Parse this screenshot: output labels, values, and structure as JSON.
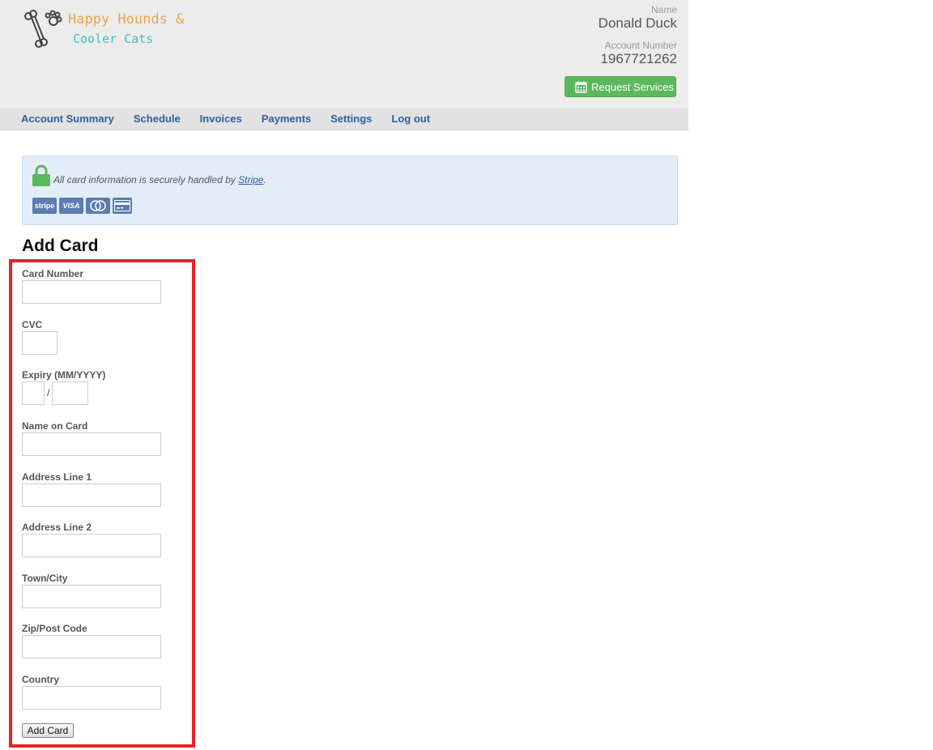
{
  "header": {
    "logo_line1": "Happy Hounds &",
    "logo_line2": "Cooler Cats",
    "name_label": "Name",
    "name_value": "Donald Duck",
    "account_label": "Account Number",
    "account_value": "1967721262",
    "request_button": "Request Services",
    "request_icon": "calendar-icon"
  },
  "nav": {
    "items": [
      "Account Summary",
      "Schedule",
      "Invoices",
      "Payments",
      "Settings",
      "Log out"
    ]
  },
  "notice": {
    "text_before": "All card information is securely handled by ",
    "link_text": "Stripe",
    "text_after": ".",
    "lock_icon": "lock-icon",
    "card_logos": [
      "stripe",
      "VISA",
      "mastercard",
      "generic-card"
    ]
  },
  "form": {
    "title": "Add Card",
    "card_number_label": "Card Number",
    "cvc_label": "CVC",
    "expiry_label": "Expiry (MM/YYYY)",
    "expiry_separator": "/",
    "name_label": "Name on Card",
    "address1_label": "Address Line 1",
    "address2_label": "Address Line 2",
    "town_label": "Town/City",
    "zip_label": "Zip/Post Code",
    "country_label": "Country",
    "submit_label": "Add Card"
  },
  "colors": {
    "header_bg": "#ececec",
    "nav_link": "#2f5fa0",
    "button_green": "#5cb85c",
    "notice_bg": "#e3edf8",
    "highlight_red": "#e3242b"
  }
}
